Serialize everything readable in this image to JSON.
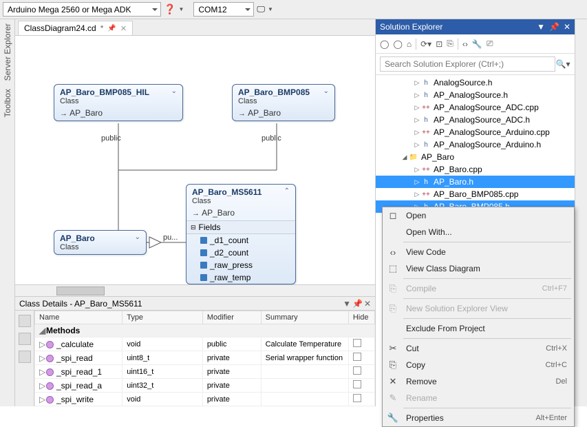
{
  "toolbar": {
    "board": "Arduino Mega 2560 or Mega ADK",
    "port": "COM12"
  },
  "left_tabs": [
    "Server Explorer",
    "Toolbox"
  ],
  "doc_tab": {
    "name": "ClassDiagram24.cd",
    "modified": "*"
  },
  "diagram": {
    "bmp085_hil": {
      "name": "AP_Baro_BMP085_HIL",
      "kind": "Class",
      "base": "AP_Baro"
    },
    "bmp085": {
      "name": "AP_Baro_BMP085",
      "kind": "Class",
      "base": "AP_Baro"
    },
    "ms5611": {
      "name": "AP_Baro_MS5611",
      "kind": "Class",
      "base": "AP_Baro",
      "section": "Fields",
      "fields": [
        "_d1_count",
        "_d2_count",
        "_raw_press",
        "_raw_temp"
      ]
    },
    "ap_baro": {
      "name": "AP_Baro",
      "kind": "Class"
    },
    "label_public1": "public",
    "label_public2": "public",
    "label_pu": "pu..."
  },
  "details": {
    "title": "Class Details - AP_Baro_MS5611",
    "cols": [
      "Name",
      "Type",
      "Modifier",
      "Summary",
      "Hide"
    ],
    "group": "Methods",
    "rows": [
      {
        "name": "_calculate",
        "type": "void",
        "mod": "public",
        "sum": "Calculate Temperature"
      },
      {
        "name": "_spi_read",
        "type": "uint8_t",
        "mod": "private",
        "sum": "Serial wrapper function"
      },
      {
        "name": "_spi_read_1",
        "type": "uint16_t",
        "mod": "private",
        "sum": ""
      },
      {
        "name": "_spi_read_a",
        "type": "uint32_t",
        "mod": "private",
        "sum": ""
      },
      {
        "name": "_spi_write",
        "type": "void",
        "mod": "private",
        "sum": ""
      }
    ]
  },
  "explorer": {
    "title": "Solution Explorer",
    "search_placeholder": "Search Solution Explorer (Ctrl+;)",
    "items": [
      {
        "ind": 2,
        "exp": "▷",
        "icon": "h",
        "name": "AnalogSource.h"
      },
      {
        "ind": 2,
        "exp": "▷",
        "icon": "h",
        "name": "AP_AnalogSource.h"
      },
      {
        "ind": 2,
        "exp": "▷",
        "icon": "cpp",
        "name": "AP_AnalogSource_ADC.cpp"
      },
      {
        "ind": 2,
        "exp": "▷",
        "icon": "h",
        "name": "AP_AnalogSource_ADC.h"
      },
      {
        "ind": 2,
        "exp": "▷",
        "icon": "cpp",
        "name": "AP_AnalogSource_Arduino.cpp"
      },
      {
        "ind": 2,
        "exp": "▷",
        "icon": "h",
        "name": "AP_AnalogSource_Arduino.h"
      },
      {
        "ind": 1,
        "exp": "◢",
        "icon": "fold",
        "name": "AP_Baro"
      },
      {
        "ind": 2,
        "exp": "▷",
        "icon": "cpp",
        "name": "AP_Baro.cpp"
      },
      {
        "ind": 2,
        "exp": "▷",
        "icon": "h",
        "name": "AP_Baro.h",
        "sel": true
      },
      {
        "ind": 2,
        "exp": "▷",
        "icon": "cpp",
        "name": "AP_Baro_BMP085.cpp"
      },
      {
        "ind": 2,
        "exp": "▷",
        "icon": "h",
        "name": "AP_Baro_BMP085.h",
        "sel": true
      }
    ]
  },
  "context_menu": [
    {
      "icon": "◻",
      "label": "Open"
    },
    {
      "icon": "",
      "label": "Open With..."
    },
    {
      "sep": true
    },
    {
      "icon": "‹›",
      "label": "View Code"
    },
    {
      "icon": "⬚",
      "label": "View Class Diagram"
    },
    {
      "sep": true
    },
    {
      "icon": "⎘",
      "label": "Compile",
      "short": "Ctrl+F7",
      "disabled": true
    },
    {
      "sep": true
    },
    {
      "icon": "⎘",
      "label": "New Solution Explorer View",
      "disabled": true
    },
    {
      "sep": true
    },
    {
      "icon": "",
      "label": "Exclude From Project"
    },
    {
      "sep": true
    },
    {
      "icon": "✂",
      "label": "Cut",
      "short": "Ctrl+X"
    },
    {
      "icon": "⎘",
      "label": "Copy",
      "short": "Ctrl+C"
    },
    {
      "icon": "✕",
      "label": "Remove",
      "short": "Del"
    },
    {
      "icon": "✎",
      "label": "Rename",
      "disabled": true
    },
    {
      "sep": true
    },
    {
      "icon": "🔧",
      "label": "Properties",
      "short": "Alt+Enter"
    }
  ]
}
